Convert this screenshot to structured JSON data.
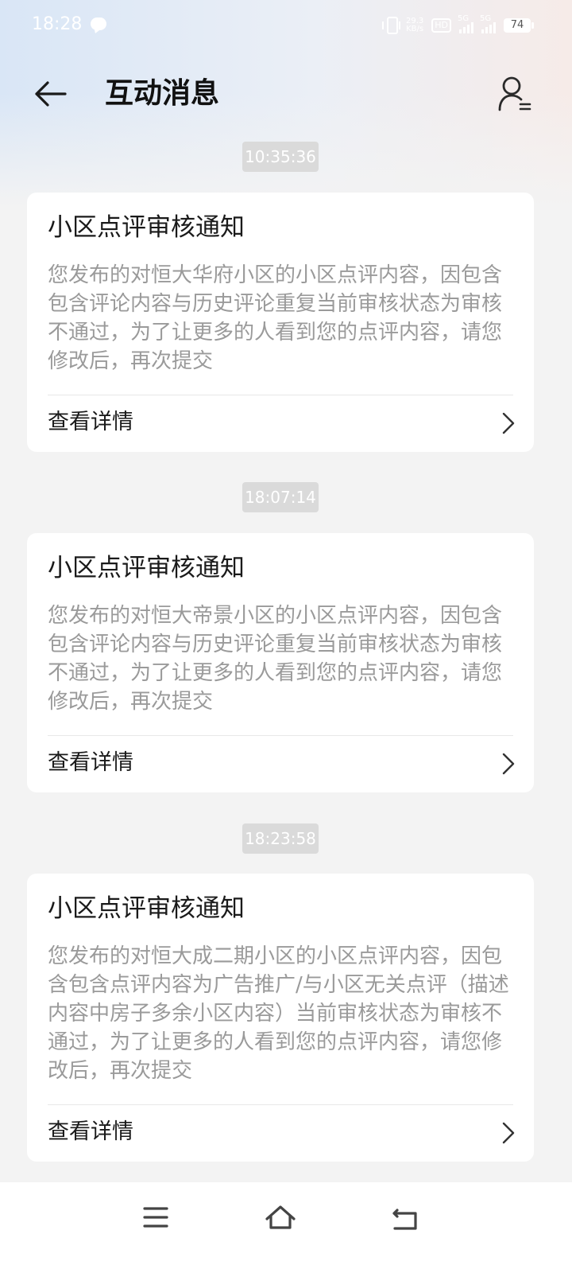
{
  "status_bar": {
    "time": "18:28",
    "net_speed_top": "29.3",
    "net_speed_bottom": "KB/s",
    "hd_label": "HD",
    "sim1": "5G",
    "sim2": "5G",
    "battery": "74"
  },
  "header": {
    "title": "互动消息"
  },
  "messages": [
    {
      "timestamp": "10:35:36",
      "title": "小区点评审核通知",
      "body": "您发布的对恒大华府小区的小区点评内容，因包含包含评论内容与历史评论重复当前审核状态为审核不通过，为了让更多的人看到您的点评内容，请您修改后，再次提交",
      "link": "查看详情"
    },
    {
      "timestamp": "18:07:14",
      "title": "小区点评审核通知",
      "body": "您发布的对恒大帝景小区的小区点评内容，因包含包含评论内容与历史评论重复当前审核状态为审核不通过，为了让更多的人看到您的点评内容，请您修改后，再次提交",
      "link": "查看详情"
    },
    {
      "timestamp": "18:23:58",
      "title": "小区点评审核通知",
      "body": "您发布的对恒大成二期小区的小区点评内容，因包含包含点评内容为广告推广/与小区无关点评（描述内容中房子多余小区内容）当前审核状态为审核不通过，为了让更多的人看到您的点评内容，请您修改后，再次提交",
      "link": "查看详情"
    }
  ],
  "icons": {
    "back": "arrow-left-icon",
    "user": "user-settings-icon",
    "chevron": "chevron-right-icon",
    "nav_menu": "menu-icon",
    "nav_home": "home-icon",
    "nav_back": "back-icon"
  }
}
